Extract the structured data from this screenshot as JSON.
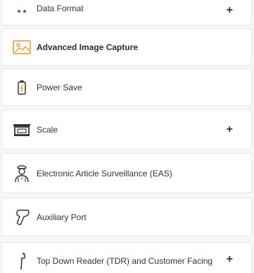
{
  "menu": {
    "items": [
      {
        "label": "Data Format",
        "icon": "data-format-icon",
        "expandable": true,
        "expand_symbol": "+"
      },
      {
        "label": "Advanced Image Capture",
        "icon": "image-icon",
        "expandable": false
      },
      {
        "label": "Power Save",
        "icon": "battery-icon",
        "expandable": false
      },
      {
        "label": "Scale",
        "icon": "scale-icon",
        "expandable": true,
        "expand_symbol": "+"
      },
      {
        "label": "Electronic Article Surveillance (EAS)",
        "icon": "security-guard-icon",
        "expandable": false
      },
      {
        "label": "Auxiliary Port",
        "icon": "auxiliary-scanner-icon",
        "expandable": false
      },
      {
        "label": "Top Down Reader (TDR) and Customer Facing",
        "icon": "tdr-reader-icon",
        "expandable": true,
        "expand_symbol": "+"
      }
    ]
  },
  "colors": {
    "icon_orange": "#e8962e",
    "icon_dark": "#333333",
    "text": "#333333",
    "border": "#e6e6e6"
  }
}
